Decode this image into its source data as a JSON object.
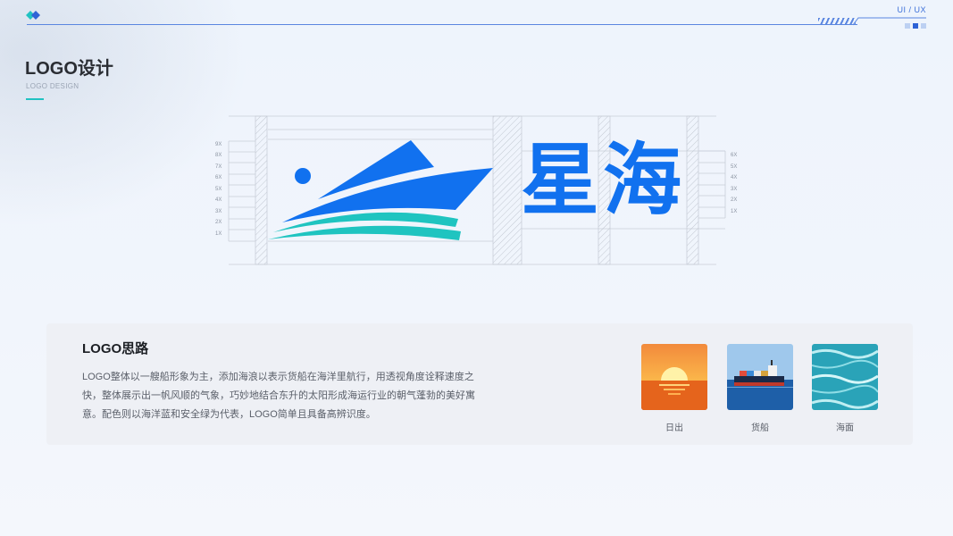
{
  "header": {
    "tag": "UI / UX",
    "title": "LOGO设计",
    "subtitle": "LOGO DESIGN"
  },
  "logo": {
    "wordmark": "星海",
    "scale_left": [
      "9X",
      "8X",
      "7X",
      "6X",
      "5X",
      "4X",
      "3X",
      "2X",
      "1X"
    ],
    "scale_right": [
      "6X",
      "5X",
      "4X",
      "3X",
      "2X",
      "1X"
    ],
    "colors": {
      "blue": "#1171ef",
      "teal": "#1fc4c0"
    }
  },
  "concept": {
    "title": "LOGO思路",
    "description": "LOGO整体以一艘船形象为主，添加海浪以表示货船在海洋里航行，用透视角度诠释速度之快，整体展示出一帆风顺的气象，巧妙地结合东升的太阳形成海运行业的朝气蓬勃的美好寓意。配色则以海洋蓝和安全绿为代表，LOGO简单且具备高辨识度。",
    "images": [
      {
        "label": "日出",
        "icon": "sunrise-photo"
      },
      {
        "label": "货船",
        "icon": "cargo-ship-photo"
      },
      {
        "label": "海面",
        "icon": "sea-surface-photo"
      }
    ]
  }
}
